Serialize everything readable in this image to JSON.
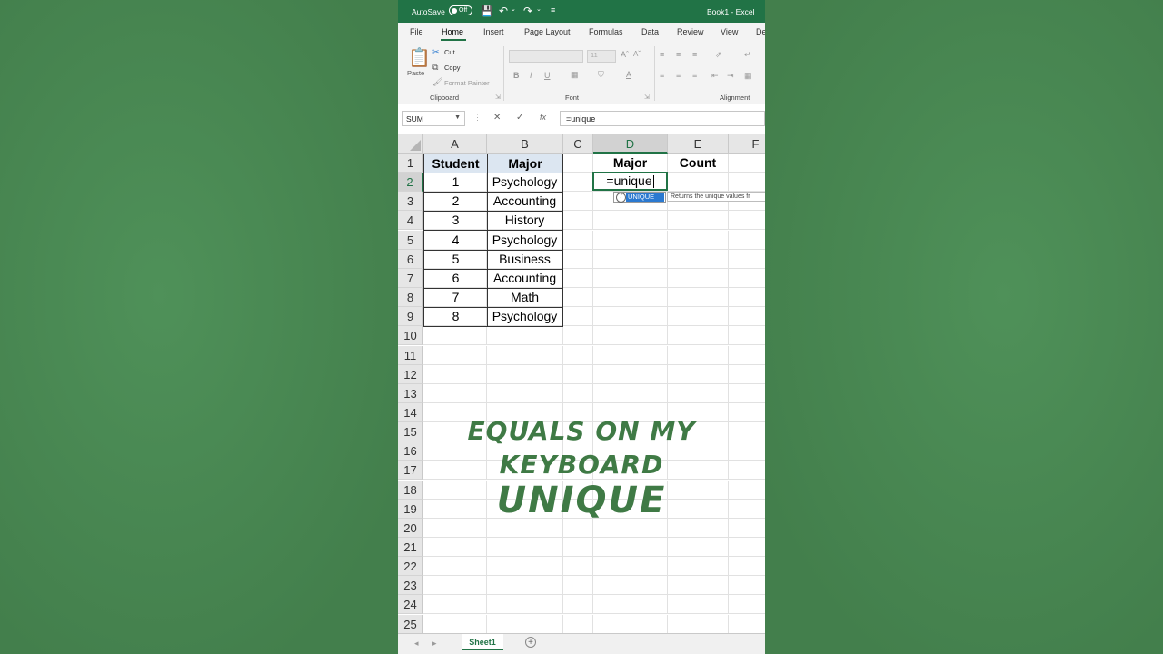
{
  "window": {
    "autosave_label": "AutoSave",
    "autosave_state": "Off",
    "title": "Book1 - Excel"
  },
  "ribbon": {
    "tabs": [
      "File",
      "Home",
      "Insert",
      "Page Layout",
      "Formulas",
      "Data",
      "Review",
      "View",
      "De"
    ],
    "active_tab": "Home",
    "clipboard": {
      "paste": "Paste",
      "cut": "Cut",
      "copy": "Copy",
      "format_painter": "Format Painter",
      "label": "Clipboard"
    },
    "font": {
      "size": "11",
      "label": "Font"
    },
    "alignment": {
      "label": "Alignment"
    }
  },
  "formula_bar": {
    "name_box": "SUM",
    "formula": "=unique"
  },
  "grid": {
    "columns": [
      "A",
      "B",
      "C",
      "D",
      "E",
      "F"
    ],
    "selected_column": "D",
    "rows": [
      "1",
      "2",
      "3",
      "4",
      "5",
      "6",
      "7",
      "8",
      "9",
      "10",
      "11",
      "12",
      "13",
      "14",
      "15",
      "16",
      "17",
      "18",
      "19",
      "20",
      "21",
      "22",
      "23",
      "24",
      "25"
    ],
    "selected_row": "2",
    "table": {
      "headers": [
        "Student",
        "Major"
      ],
      "rows": [
        [
          "1",
          "Psychology"
        ],
        [
          "2",
          "Accounting"
        ],
        [
          "3",
          "History"
        ],
        [
          "4",
          "Psychology"
        ],
        [
          "5",
          "Business"
        ],
        [
          "6",
          "Accounting"
        ],
        [
          "7",
          "Math"
        ],
        [
          "8",
          "Psychology"
        ]
      ]
    },
    "d1": "Major",
    "e1": "Count",
    "active_cell_value": "=unique",
    "autocomplete_item": "UNIQUE",
    "tooltip": "Returns the unique values fr"
  },
  "overlay": {
    "line1": "EQUALS ON MY",
    "line2": "KEYBOARD",
    "line3": "UNIQUE"
  },
  "sheets": {
    "active": "Sheet1"
  },
  "colors": {
    "excel_green": "#217346",
    "background_green": "#4a8a54",
    "overlay_text": "#3f7a45",
    "table_header_fill": "#dce6f1"
  }
}
